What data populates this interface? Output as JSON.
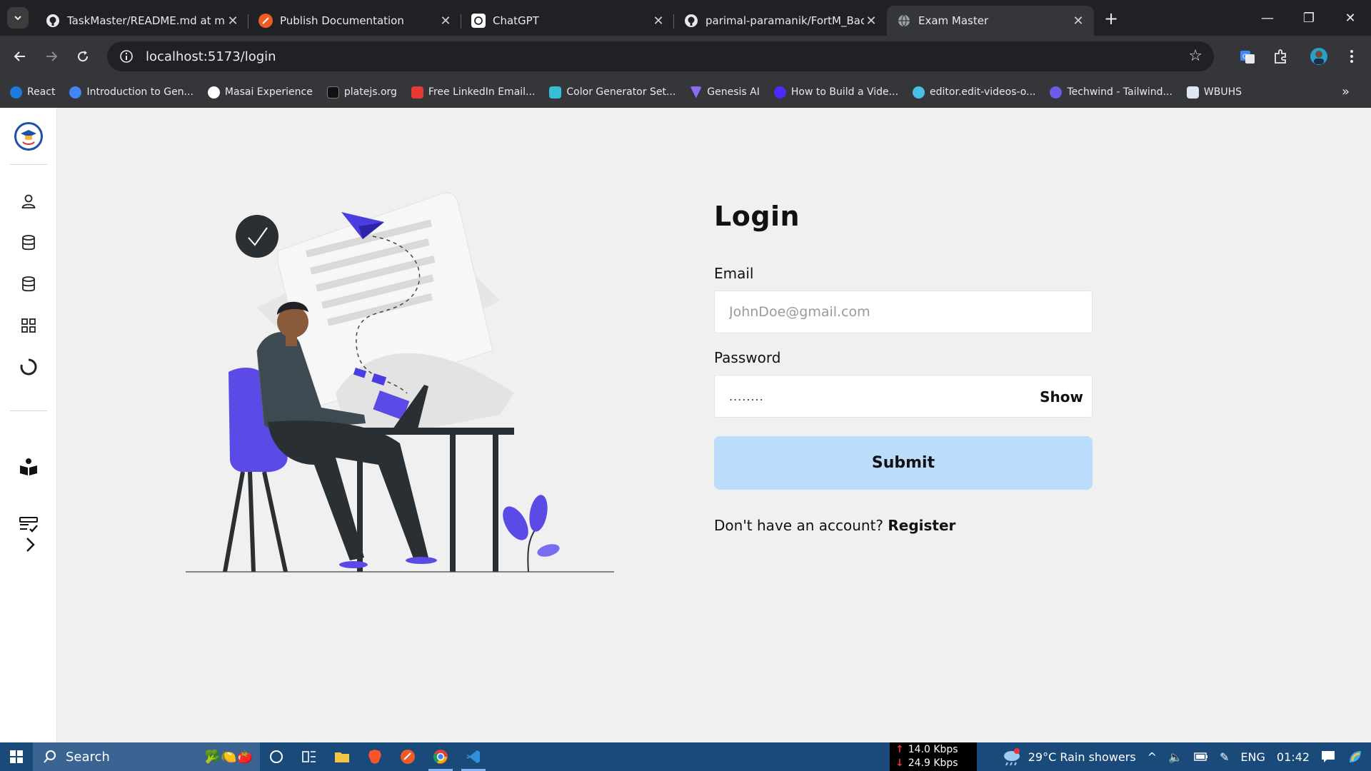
{
  "browser": {
    "tabs": [
      {
        "title": "TaskMaster/README.md at mai",
        "icon": "github-icon",
        "active": false
      },
      {
        "title": "Publish Documentation",
        "icon": "postman-icon",
        "active": false
      },
      {
        "title": "ChatGPT",
        "icon": "chatgpt-icon",
        "active": false
      },
      {
        "title": "parimal-paramanik/FortM_Back",
        "icon": "github-icon",
        "active": false
      },
      {
        "title": "Exam Master",
        "icon": "globe-icon",
        "active": true
      }
    ],
    "new_tab_label": "+",
    "url": "localhost:5173/login",
    "bookmarks": [
      {
        "label": "React",
        "color": "#1f7ae0"
      },
      {
        "label": "Introduction to Gen...",
        "color": "#4285f4"
      },
      {
        "label": "Masai Experience",
        "color": "#ffffff"
      },
      {
        "label": "platejs.org",
        "color": "#111111"
      },
      {
        "label": "Free LinkedIn Email...",
        "color": "#e53935"
      },
      {
        "label": "Color Generator Set...",
        "color": "#35c0d6"
      },
      {
        "label": "Genesis AI",
        "color": "#8e6cf0"
      },
      {
        "label": "How to Build a Vide...",
        "color": "#4b2bff"
      },
      {
        "label": "editor.edit-videos-o...",
        "color": "#4ac0e8"
      },
      {
        "label": "Techwind - Tailwind...",
        "color": "#6c5ce7"
      },
      {
        "label": "WBUHS",
        "color": "#dfe7f2"
      }
    ]
  },
  "sidebar": {
    "items": [
      {
        "icon": "user-icon"
      },
      {
        "icon": "database-icon"
      },
      {
        "icon": "database-icon"
      },
      {
        "icon": "grid-icon"
      },
      {
        "icon": "loading-circle-icon"
      },
      {
        "icon": "reader-icon"
      },
      {
        "icon": "checklist-icon"
      },
      {
        "icon": "chevron-right-icon"
      }
    ]
  },
  "login": {
    "title": "Login",
    "email_label": "Email",
    "email_placeholder": "JohnDoe@gmail.com",
    "password_label": "Password",
    "password_value": "........",
    "show_label": "Show",
    "submit_label": "Submit",
    "register_prompt": "Don't have an account?",
    "register_link": "Register"
  },
  "colors": {
    "accent_purple": "#5b4ae6",
    "submit_bg": "#bcdcfb",
    "page_bg": "#f0f0f0"
  },
  "taskbar": {
    "search_placeholder": "Search",
    "net_up": "14.0 Kbps",
    "net_down": "24.9 Kbps",
    "weather": "29°C  Rain showers",
    "weather_badge": "1",
    "language": "ENG",
    "time": "01:42"
  }
}
